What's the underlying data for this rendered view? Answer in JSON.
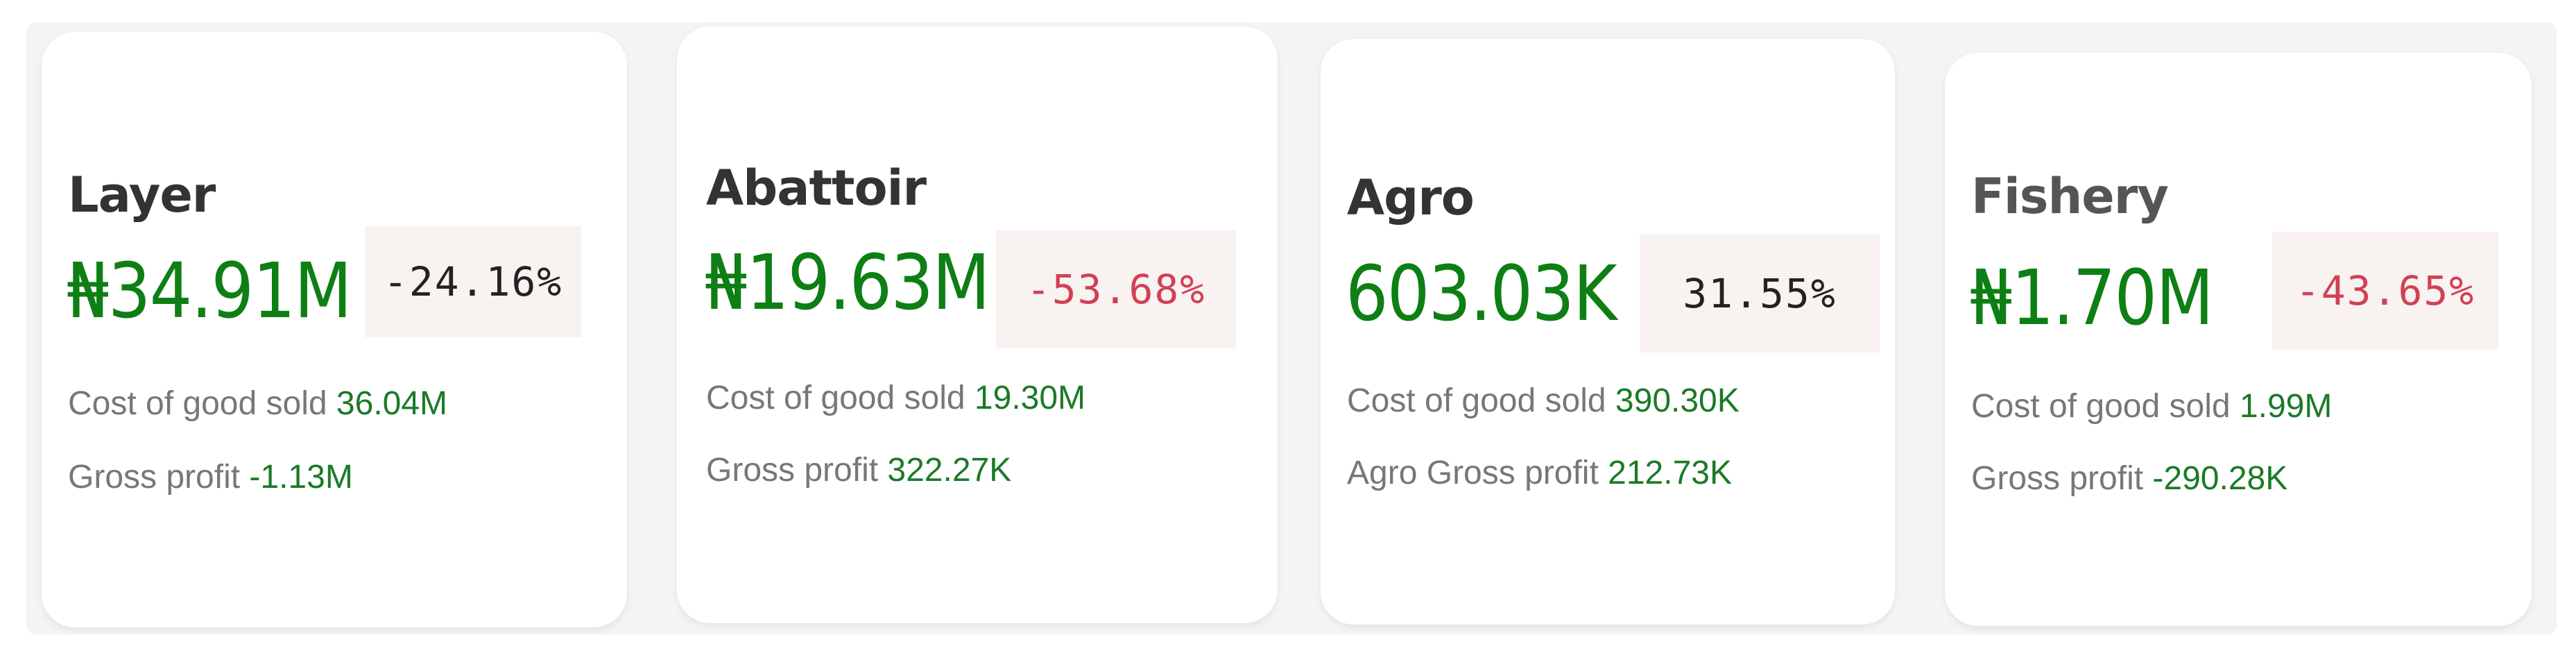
{
  "colors": {
    "value_green": "#0e7f14",
    "metric_value_green": "#1a7a26",
    "title_dark": "#333333",
    "title_gray": "#555555",
    "label_gray": "#777777",
    "negative_red": "#d14055",
    "neutral_dark": "#222222",
    "change_box_bg": "#f8f2f0",
    "panel_bg": "#f4f3f6"
  },
  "cards": [
    {
      "title": "Layer",
      "value": "₦34.91M",
      "change": "-24.16%",
      "change_sentiment": "neutral",
      "metrics": [
        {
          "label": "Cost of good sold",
          "value": "36.04M"
        },
        {
          "label": "Gross profit",
          "value": "-1.13M"
        }
      ]
    },
    {
      "title": "Abattoir",
      "value": "₦19.63M",
      "change": "-53.68%",
      "change_sentiment": "negative",
      "metrics": [
        {
          "label": "Cost of good sold",
          "value": "19.30M"
        },
        {
          "label": "Gross profit",
          "value": "322.27K"
        }
      ]
    },
    {
      "title": "Agro",
      "value": "603.03K",
      "change": "31.55%",
      "change_sentiment": "neutral",
      "metrics": [
        {
          "label": "Cost of good sold",
          "value": "390.30K"
        },
        {
          "label": "Agro Gross profit",
          "value": "212.73K"
        }
      ]
    },
    {
      "title": "Fishery",
      "value": "₦1.70M",
      "change": "-43.65%",
      "change_sentiment": "negative",
      "metrics": [
        {
          "label": "Cost of good sold",
          "value": "1.99M"
        },
        {
          "label": "Gross profit",
          "value": "-290.28K"
        }
      ]
    }
  ]
}
